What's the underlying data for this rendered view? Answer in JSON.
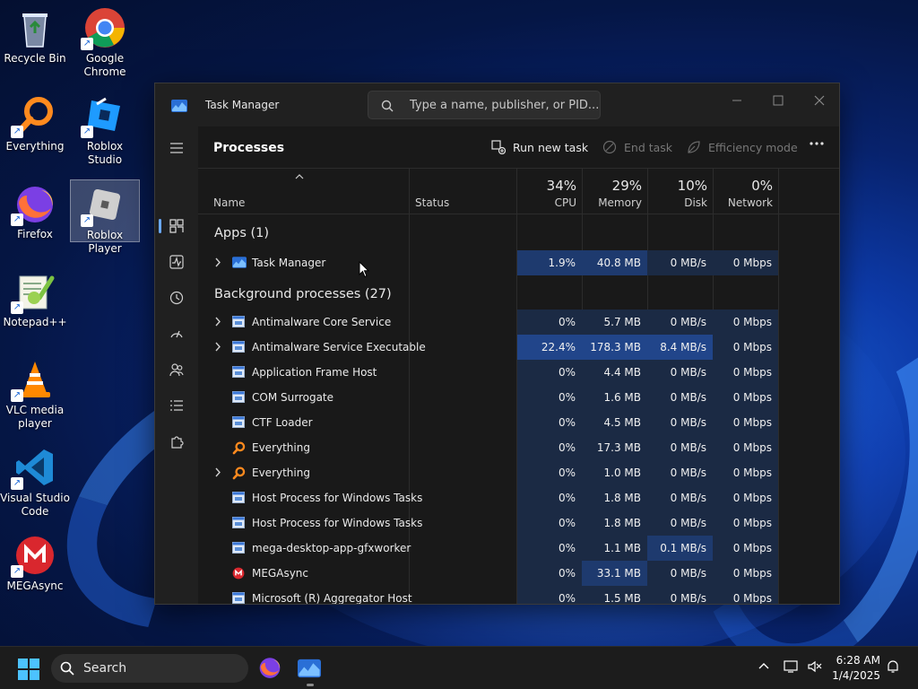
{
  "desktop": {
    "icons": [
      {
        "label": "Recycle Bin"
      },
      {
        "label": "Google Chrome"
      },
      {
        "label": "Everything"
      },
      {
        "label": "Roblox Studio"
      },
      {
        "label": "Firefox"
      },
      {
        "label": "Roblox Player"
      },
      {
        "label": "Notepad++"
      },
      {
        "label": "VLC media player"
      },
      {
        "label": "Visual Studio Code"
      },
      {
        "label": "MEGAsync"
      }
    ]
  },
  "window": {
    "title": "Task Manager",
    "search_placeholder": "Type a name, publisher, or PID...",
    "page_title": "Processes",
    "toolbar": {
      "run_new_task": "Run new task",
      "end_task": "End task",
      "efficiency_mode": "Efficiency mode"
    },
    "columns": {
      "name": "Name",
      "status": "Status",
      "cpu": {
        "pct": "34%",
        "label": "CPU"
      },
      "memory": {
        "pct": "29%",
        "label": "Memory"
      },
      "disk": {
        "pct": "10%",
        "label": "Disk"
      },
      "network": {
        "pct": "0%",
        "label": "Network"
      }
    },
    "groups": {
      "apps": "Apps (1)",
      "background": "Background processes (27)"
    },
    "apps": [
      {
        "name": "Task Manager",
        "cpu": "1.9%",
        "memory": "40.8 MB",
        "disk": "0 MB/s",
        "network": "0 Mbps"
      }
    ],
    "background": [
      {
        "name": "Antimalware Core Service",
        "cpu": "0%",
        "memory": "5.7 MB",
        "disk": "0 MB/s",
        "network": "0 Mbps"
      },
      {
        "name": "Antimalware Service Executable",
        "cpu": "22.4%",
        "memory": "178.3 MB",
        "disk": "8.4 MB/s",
        "network": "0 Mbps"
      },
      {
        "name": "Application Frame Host",
        "cpu": "0%",
        "memory": "4.4 MB",
        "disk": "0 MB/s",
        "network": "0 Mbps"
      },
      {
        "name": "COM Surrogate",
        "cpu": "0%",
        "memory": "1.6 MB",
        "disk": "0 MB/s",
        "network": "0 Mbps"
      },
      {
        "name": "CTF Loader",
        "cpu": "0%",
        "memory": "4.5 MB",
        "disk": "0 MB/s",
        "network": "0 Mbps"
      },
      {
        "name": "Everything",
        "cpu": "0%",
        "memory": "17.3 MB",
        "disk": "0 MB/s",
        "network": "0 Mbps"
      },
      {
        "name": "Everything",
        "cpu": "0%",
        "memory": "1.0 MB",
        "disk": "0 MB/s",
        "network": "0 Mbps"
      },
      {
        "name": "Host Process for Windows Tasks",
        "cpu": "0%",
        "memory": "1.8 MB",
        "disk": "0 MB/s",
        "network": "0 Mbps"
      },
      {
        "name": "Host Process for Windows Tasks",
        "cpu": "0%",
        "memory": "1.8 MB",
        "disk": "0 MB/s",
        "network": "0 Mbps"
      },
      {
        "name": "mega-desktop-app-gfxworker",
        "cpu": "0%",
        "memory": "1.1 MB",
        "disk": "0.1 MB/s",
        "network": "0 Mbps"
      },
      {
        "name": "MEGAsync",
        "cpu": "0%",
        "memory": "33.1 MB",
        "disk": "0 MB/s",
        "network": "0 Mbps"
      },
      {
        "name": "Microsoft (R) Aggregator Host",
        "cpu": "0%",
        "memory": "1.5 MB",
        "disk": "0 MB/s",
        "network": "0 Mbps"
      }
    ]
  },
  "taskbar": {
    "search_label": "Search",
    "time": "6:28 AM",
    "date": "1/4/2025"
  },
  "colors": {
    "accent": "#6aa9ff",
    "heat_low": "#1b2a44",
    "heat_mid": "#1e3a6e",
    "heat_high": "#21458a"
  }
}
